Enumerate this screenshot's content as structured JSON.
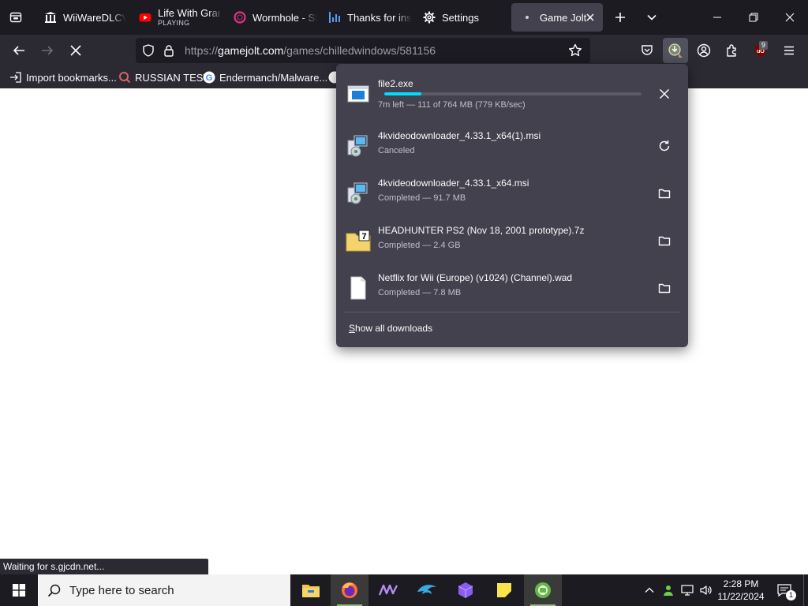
{
  "browser": {
    "tabs": [
      {
        "title": "WiiWareDLCV",
        "icon": "library-icon"
      },
      {
        "title": "Life With Gran",
        "subtitle": "PLAYING",
        "icon": "youtube-icon"
      },
      {
        "title": "Wormhole - Sl",
        "icon": "wormhole-icon"
      },
      {
        "title": "Thanks for inst",
        "icon": "chart-icon"
      },
      {
        "title": "Settings",
        "icon": "gear-icon"
      },
      {
        "title": "Game Jolt -",
        "icon": "loading-dot-icon",
        "active": true
      }
    ],
    "url": {
      "scheme": "https://",
      "host": "gamejolt.com",
      "path": "/games/chilledwindows/581156"
    },
    "toolbar_badge_count": "9",
    "bookmarks": [
      {
        "label": "Import bookmarks...",
        "icon": "import-icon"
      },
      {
        "label": "RUSSIAN TEST",
        "icon": "search-loop-icon"
      },
      {
        "label": "Endermanch/Malware...",
        "icon": "google-icon"
      }
    ]
  },
  "downloads": {
    "items": [
      {
        "name": "file2.exe",
        "status": "7m left — 111 of 764 MB (779 KB/sec)",
        "progress": 0.145,
        "action": "cancel",
        "icon": "exe-file-icon"
      },
      {
        "name": "4kvideodownloader_4.33.1_x64(1).msi",
        "status": "Canceled",
        "action": "retry",
        "icon": "msi-installer-icon"
      },
      {
        "name": "4kvideodownloader_4.33.1_x64.msi",
        "status": "Completed — 91.7 MB",
        "action": "open-folder",
        "icon": "msi-installer-icon"
      },
      {
        "name": "HEADHUNTER PS2 (Nov 18, 2001 prototype).7z",
        "status": "Completed — 2.4 GB",
        "action": "open-folder",
        "icon": "7z-archive-icon"
      },
      {
        "name": "Netflix for Wii (Europe) (v1024) (Channel).wad",
        "status": "Completed — 7.8 MB",
        "action": "open-folder",
        "icon": "blank-file-icon"
      }
    ],
    "show_all_label_accel": "S",
    "show_all_label_rest": "how all downloads"
  },
  "status_text": "Waiting for s.gjcdn.net...",
  "taskbar": {
    "search_placeholder": "Type here to search",
    "time": "2:28 PM",
    "date": "11/22/2024",
    "notification_count": "1"
  },
  "colors": {
    "tabbar_bg": "#1c1b22",
    "toolbar_bg": "#2b2a33",
    "panel_bg": "#42414d",
    "progress_accent": "#00ddff"
  }
}
